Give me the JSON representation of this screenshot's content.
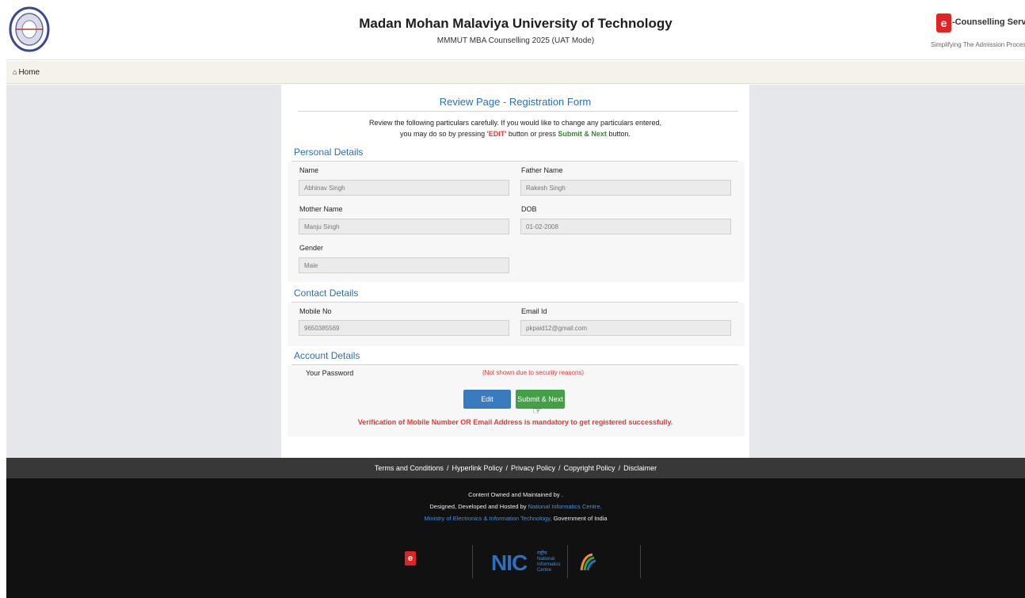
{
  "header": {
    "university": "Madan Mohan Malaviya University of Technology",
    "subtitle": "MMMUT MBA Counselling 2025 (UAT Mode)",
    "brand_mark": "e",
    "brand_name": "-Counselling Services",
    "brand_tagline": "Simplifying The Admission Process"
  },
  "nav": {
    "home": "Home"
  },
  "review": {
    "title": "Review Page - Registration Form",
    "instr_line1": "Review the following particulars carefully. If you would like to change any particulars entered,",
    "instr_prefix": "you may do so by pressing ",
    "instr_edit": "'EDIT'",
    "instr_mid": " button or press ",
    "instr_submit": "Submit & Next",
    "instr_suffix": " button."
  },
  "personal": {
    "heading": "Personal Details",
    "name_label": "Name",
    "name_value": "Abhinav Singh",
    "father_label": "Father Name",
    "father_value": "Rakesh Singh",
    "mother_label": "Mother Name",
    "mother_value": "Manju Singh",
    "dob_label": "DOB",
    "dob_value": "01-02-2008",
    "gender_label": "Gender",
    "gender_value": "Male"
  },
  "contact": {
    "heading": "Contact Details",
    "mobile_label": "Mobile No",
    "mobile_value": "9650385569",
    "email_label": "Email Id",
    "email_value": "pkpaid12@gmail.com"
  },
  "account": {
    "heading": "Account Details",
    "password_label": "Your Password",
    "password_note": "(Not shown due to security reasons)"
  },
  "actions": {
    "edit": "Edit",
    "submit": "Submit & Next",
    "verify_msg": "Verification of Mobile Number OR Email Address is mandatory to get registered successfully."
  },
  "footer": {
    "links": [
      "Terms and Conditions",
      "Hyperlink Policy",
      "Privacy Policy",
      "Copyright Policy",
      "Disclaimer"
    ],
    "content_owned": "Content Owned and Maintained by .",
    "designed_prefix": "Designed, Developed and Hosted by ",
    "nic_link": "National Informatics Centre,",
    "ministry_link": "Ministry of Electronics & Information Technology,",
    "gov": " Government of India",
    "nic_logo": "NIC",
    "nic_hindi": "राष्ट्रीय",
    "nic_line1": "National",
    "nic_line2": "Informatics",
    "nic_line3": "Centre"
  },
  "colors": {
    "accent": "#2b6fb2",
    "error": "#e53935",
    "success": "#43a047",
    "edit_button": "#3a7bbf"
  }
}
